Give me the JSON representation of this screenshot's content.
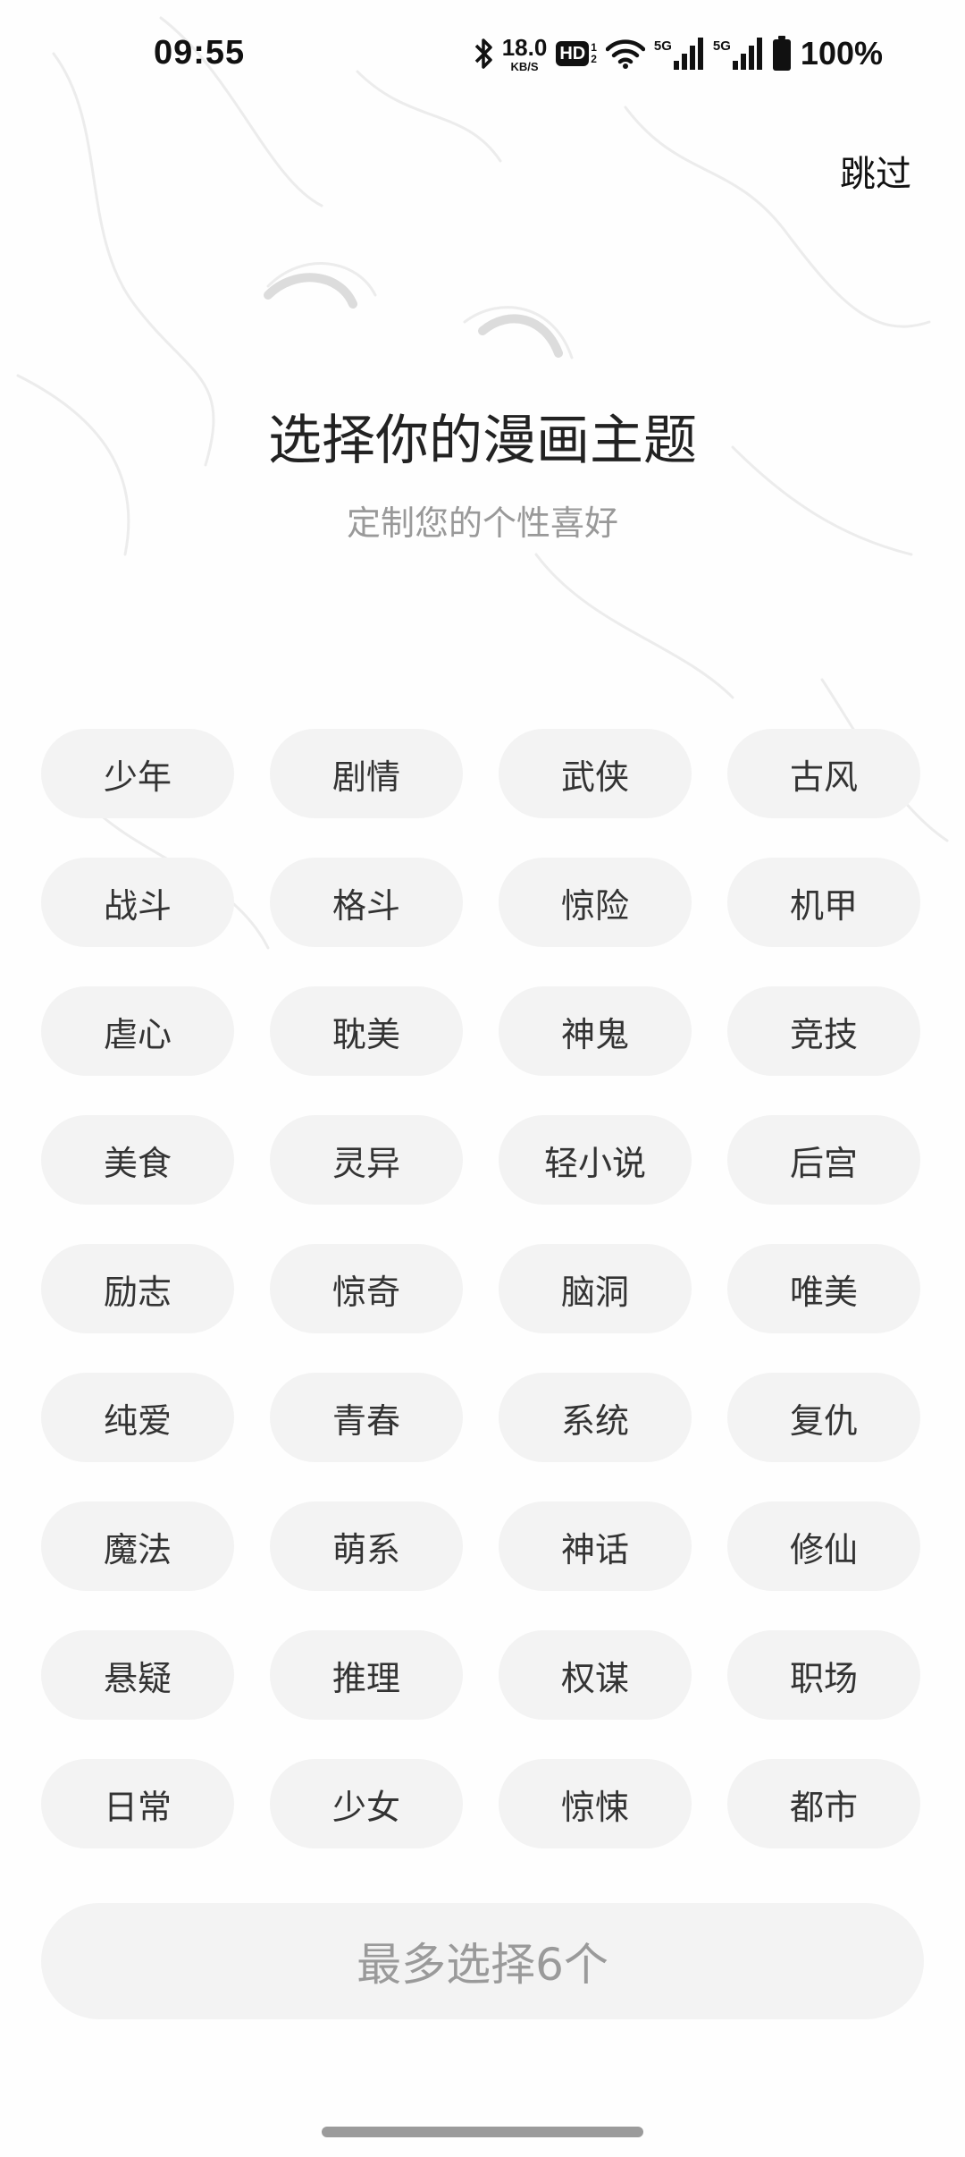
{
  "status_bar": {
    "time": "09:55",
    "net_speed_value": "18.0",
    "net_speed_unit": "KB/S",
    "hd_label": "HD",
    "hd_sub_1": "1",
    "hd_sub_2": "2",
    "signal_1_label": "5G",
    "signal_2_label": "5G",
    "battery_percent": "100%",
    "icons": [
      "bluetooth-icon",
      "hd-icon",
      "wifi-icon",
      "signal-icon",
      "signal-icon",
      "battery-icon"
    ]
  },
  "header": {
    "skip_label": "跳过"
  },
  "main": {
    "title": "选择你的漫画主题",
    "subtitle": "定制您的个性喜好",
    "topics": [
      "少年",
      "剧情",
      "武侠",
      "古风",
      "战斗",
      "格斗",
      "惊险",
      "机甲",
      "虐心",
      "耽美",
      "神鬼",
      "竞技",
      "美食",
      "灵异",
      "轻小说",
      "后宫",
      "励志",
      "惊奇",
      "脑洞",
      "唯美",
      "纯爱",
      "青春",
      "系统",
      "复仇",
      "魔法",
      "萌系",
      "神话",
      "修仙",
      "悬疑",
      "推理",
      "权谋",
      "职场",
      "日常",
      "少女",
      "惊悚",
      "都市"
    ],
    "confirm_label": "最多选择6个"
  },
  "colors": {
    "tag_background": "#f3f3f3",
    "tag_text": "#333333",
    "subtitle_text": "#999999",
    "button_text_disabled": "#9a9a9a"
  }
}
